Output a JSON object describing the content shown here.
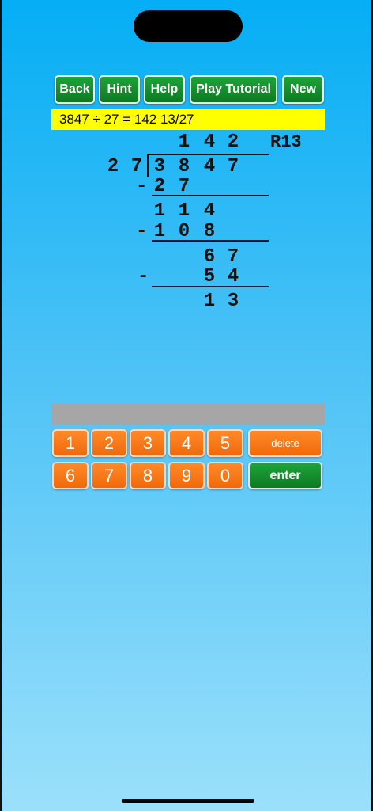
{
  "toolbar": {
    "back": "Back",
    "hint": "Hint",
    "help": "Help",
    "tutorial": "Play Tutorial",
    "new": "New"
  },
  "problem_text": "3847 ÷ 27 = 142 13/27",
  "work": {
    "quotient": [
      "1",
      "4",
      "2"
    ],
    "remainder": "R13",
    "divisor": [
      "2",
      "7"
    ],
    "dividend": [
      "3",
      "8",
      "4",
      "7"
    ],
    "sub1": [
      "2",
      "7"
    ],
    "diff1": [
      "1",
      "1",
      "4"
    ],
    "sub2": [
      "1",
      "0",
      "8"
    ],
    "diff2": [
      "6",
      "7"
    ],
    "sub3": [
      "5",
      "4"
    ],
    "final": [
      "1",
      "3"
    ],
    "minus": "-"
  },
  "entry_value": "",
  "keypad": {
    "row1": [
      "1",
      "2",
      "3",
      "4",
      "5"
    ],
    "row2": [
      "6",
      "7",
      "8",
      "9",
      "0"
    ],
    "delete": "delete",
    "enter": "enter"
  },
  "colors": {
    "toolbar_button": "#0d7a22",
    "number_key": "#f0690b",
    "enter_key": "#0d7a22",
    "problem_bg": "#ffff00",
    "entry_bg": "#a6a6a6"
  }
}
